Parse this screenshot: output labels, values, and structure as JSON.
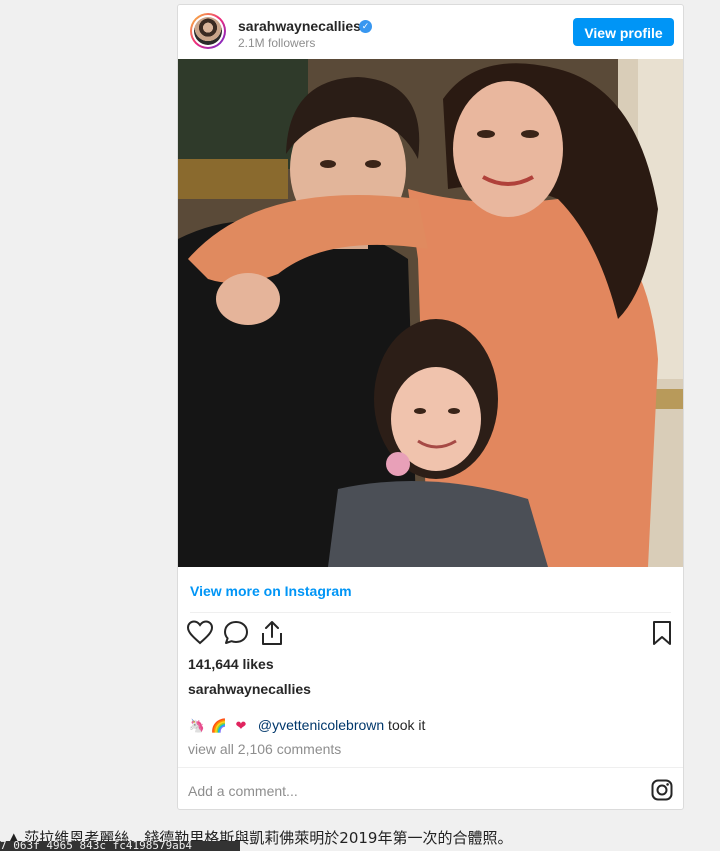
{
  "post": {
    "username": "sarahwaynecallies",
    "followers": "2.1M followers",
    "view_profile_label": "View profile",
    "view_more_label": "View more on Instagram",
    "likes": "141,644 likes",
    "caption_username": "sarahwaynecallies",
    "comment": {
      "emojis": [
        "unicorn-emoji",
        "rainbow-emoji",
        "heart-emoji"
      ],
      "mention": "@yvettenicolebrown",
      "text": " took it"
    },
    "view_all_comments": "view all 2,106 comments",
    "add_comment_placeholder": "Add a comment..."
  },
  "page_caption": "▲ 莎拉維恩考麗絲、錢德勒里格斯與凱莉佛萊明於2019年第一次的合體照。",
  "tooltip_text": "7_063f_4965_843c_fc4198579ab4",
  "colors": {
    "accent": "#0095f6",
    "link": "#00376b",
    "muted": "#8e8e8e",
    "text": "#262626",
    "border": "#dbdbdb",
    "page_bg": "#f0f0f0"
  }
}
